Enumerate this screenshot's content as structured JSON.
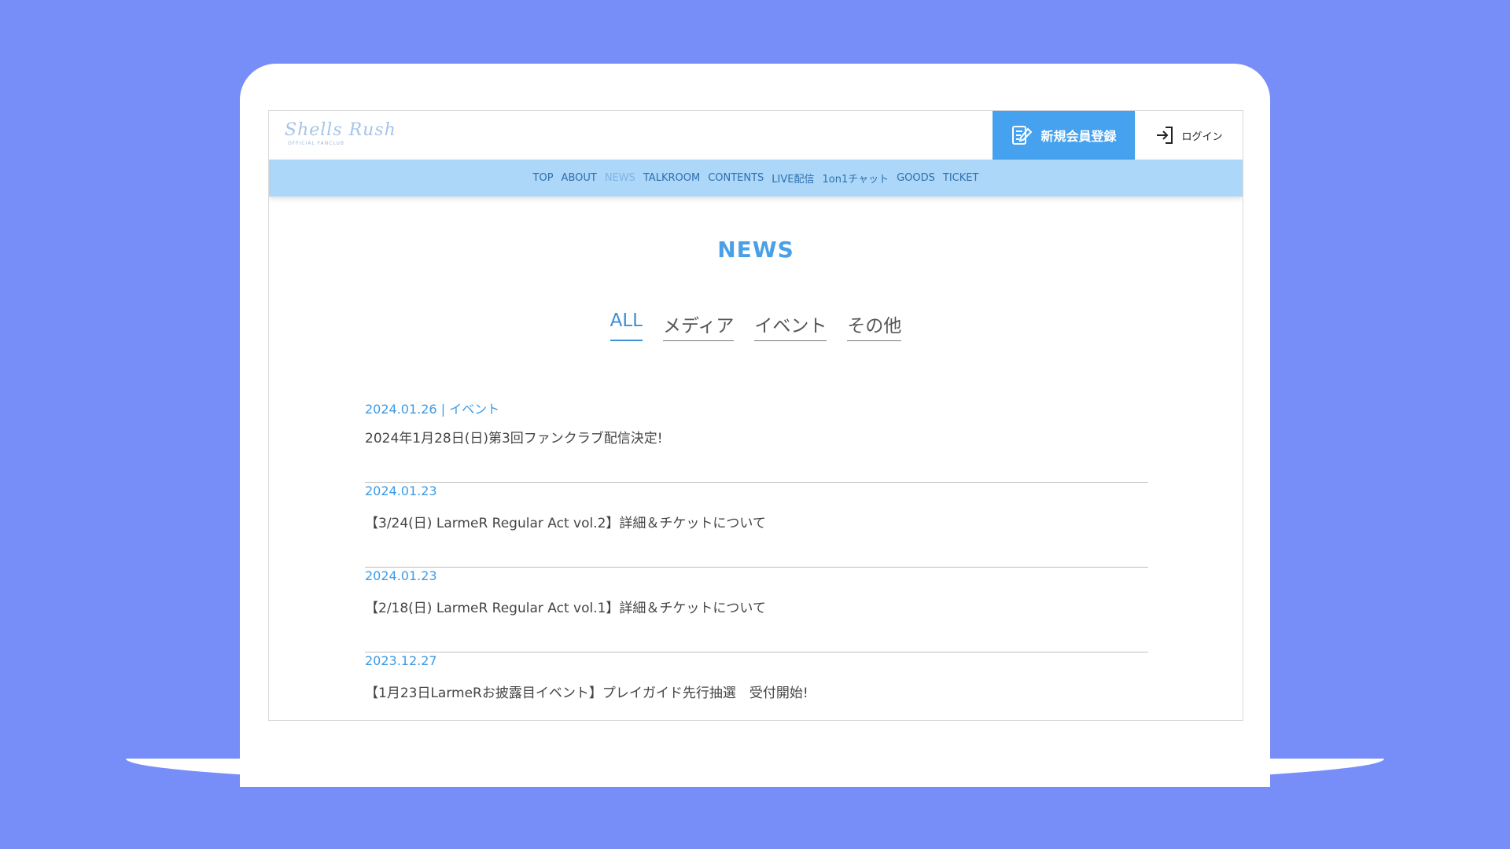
{
  "logo": {
    "text": "Shells Rush",
    "subtext": "OFFICIAL FANCLUB"
  },
  "header": {
    "register_label": "新規会員登録",
    "login_label": "ログイン"
  },
  "nav": {
    "items": [
      {
        "label": "TOP"
      },
      {
        "label": "ABOUT"
      },
      {
        "label": "NEWS"
      },
      {
        "label": "TALKROOM"
      },
      {
        "label": "CONTENTS"
      },
      {
        "label": "LIVE配信"
      },
      {
        "label": "1on1チャット"
      },
      {
        "label": "GOODS"
      },
      {
        "label": "TICKET"
      }
    ],
    "active_item": "NEWS"
  },
  "page": {
    "title": "NEWS"
  },
  "tabs": {
    "items": [
      {
        "label": "ALL"
      },
      {
        "label": "メディア"
      },
      {
        "label": "イベント"
      },
      {
        "label": "その他"
      }
    ],
    "active_item": "ALL"
  },
  "news": [
    {
      "meta": "2024.01.26 | イベント",
      "title": "2024年1月28日(日)第3回ファンクラブ配信決定!"
    },
    {
      "meta": "2024.01.23",
      "title": "【3/24(日) LarmeR Regular Act vol.2】詳細＆チケットについて"
    },
    {
      "meta": "2024.01.23",
      "title": "【2/18(日) LarmeR Regular Act vol.1】詳細＆チケットについて"
    },
    {
      "meta": "2023.12.27",
      "title": "【1月23日LarmeRお披露目イベント】プレイガイド先行抽選　受付開始!"
    }
  ],
  "colors": {
    "background": "#778ef8",
    "accent": "#46a2ee",
    "nav_bg": "#acd7f8",
    "nav_text": "#2d6fb0"
  }
}
